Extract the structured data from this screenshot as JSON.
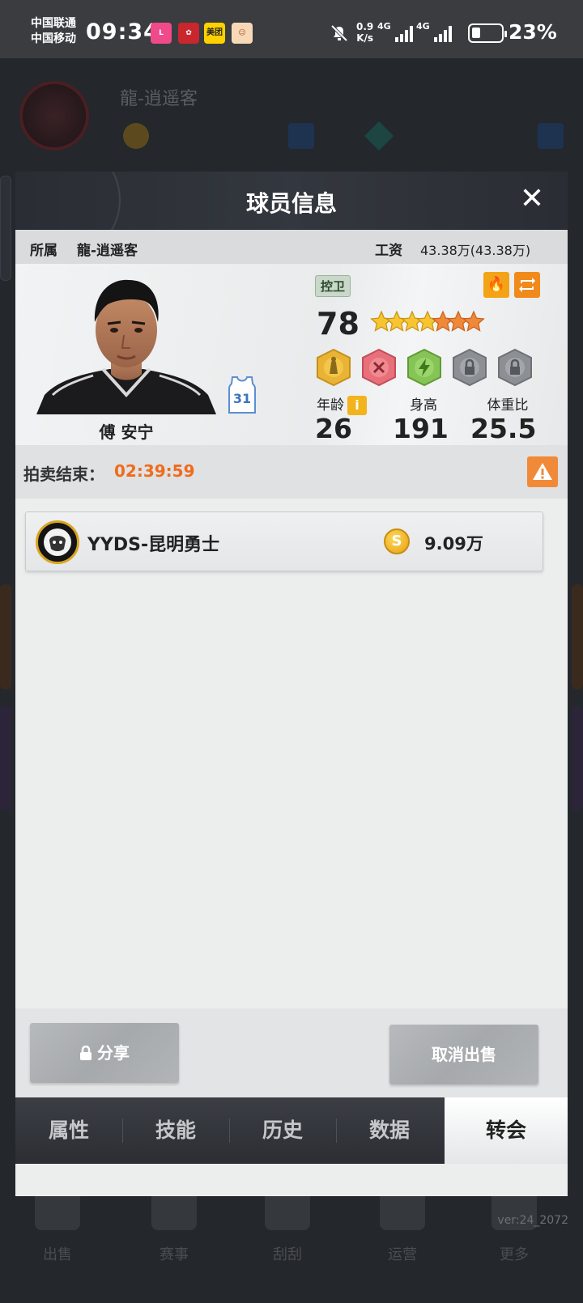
{
  "status_bar": {
    "carrier_1": "中国联通",
    "carrier_2": "中国移动",
    "time": "09:34",
    "net_speed_value": "0.9",
    "net_speed_unit": "K/s",
    "signal_1_label": "4G",
    "signal_2_label": "4G",
    "battery_percent": "23%",
    "app_icons": [
      "lofter-icon",
      "red-app-icon",
      "meituan-icon",
      "cartoon-app-icon"
    ],
    "meituan_label": "美团"
  },
  "background": {
    "team_name": "龍-逍遥客",
    "nav_labels": [
      "出售",
      "赛事",
      "刮刮",
      "运营",
      "更多"
    ],
    "version": "ver:24_2072"
  },
  "modal": {
    "title": "球员信息",
    "close_icon": "close-icon",
    "team_label": "所属",
    "team_value": "龍-逍遥客",
    "salary_label": "工资",
    "salary_value": "43.38万(43.38万)",
    "player": {
      "name": "傅 安宁",
      "jersey_number": "31",
      "position": "控卫",
      "rating": "78",
      "stars_total": 7,
      "stars_gold": 4,
      "age_label": "年龄",
      "age_value": "26",
      "height_label": "身高",
      "height_value": "191",
      "weight_ratio_label": "体重比",
      "weight_ratio_value": "25.5"
    },
    "auction": {
      "label": "拍卖结束：",
      "countdown": "02:39:59"
    },
    "bids": [
      {
        "team": "YYDS-昆明勇士",
        "amount": "9.09万"
      }
    ],
    "buttons": {
      "share": "分享",
      "cancel_sale": "取消出售"
    },
    "tabs": [
      "属性",
      "技能",
      "历史",
      "数据",
      "转会"
    ],
    "active_tab": "转会"
  },
  "colors": {
    "accent_orange": "#f06b1c",
    "gold": "#f3b31c",
    "header_dark": "#2d3036"
  }
}
